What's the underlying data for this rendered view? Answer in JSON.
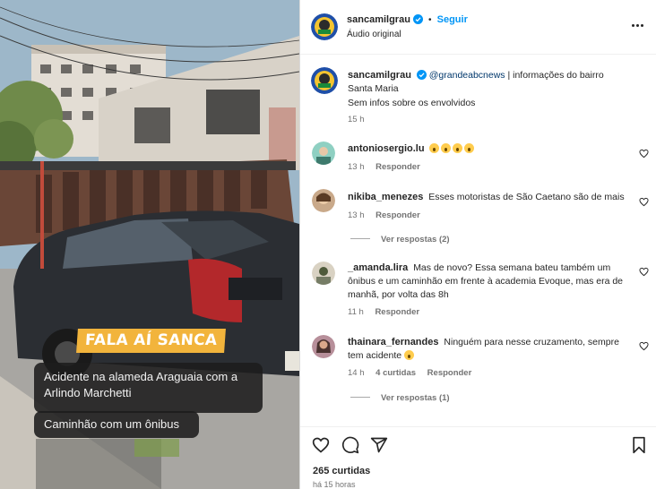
{
  "media": {
    "banner": "FALA AÍ SANCA",
    "caption_1": "Acidente na alameda Araguaia com a Arlindo Marchetti",
    "caption_2": "Caminhão com um ônibus"
  },
  "header": {
    "username": "sancamilgrau",
    "follow_label": "Seguir",
    "separator": "•",
    "audio_label": "Áudio original"
  },
  "caption_post": {
    "username": "sancamilgrau",
    "mention": "@grandeabcnews",
    "text": " | informações do bairro Santa Maria",
    "line2": "Sem infos sobre os envolvidos",
    "time": "15 h"
  },
  "comments": [
    {
      "username": "antoniosergio.lu",
      "text": "",
      "emoji_count": 4,
      "time": "13 h",
      "likes": "",
      "reply": "Responder",
      "view_replies": ""
    },
    {
      "username": "nikiba_menezes",
      "text": "Esses motoristas de São Caetano são de mais",
      "time": "13 h",
      "likes": "",
      "reply": "Responder",
      "view_replies": "Ver respostas (2)"
    },
    {
      "username": "_amanda.lira",
      "text": "Mas de novo? Essa semana bateu também um ônibus e um caminhão em frente à academia Evoque, mas era de manhã, por volta das 8h",
      "time": "11 h",
      "likes": "",
      "reply": "Responder",
      "view_replies": ""
    },
    {
      "username": "thainara_fernandes",
      "text": "Ninguém para nesse cruzamento, sempre tem acidente",
      "time": "14 h",
      "likes": "4 curtidas",
      "reply": "Responder",
      "view_replies": "Ver respostas (1)"
    }
  ],
  "footer": {
    "likes": "265 curtidas",
    "ago": "há 15 horas"
  },
  "colors": {
    "accent": "#0095f6",
    "mention": "#00376b",
    "muted": "#737373",
    "banner": "#f2b43c"
  },
  "icons": [
    "verified-badge-icon",
    "more-options-icon",
    "heart-icon",
    "comment-icon",
    "share-icon",
    "bookmark-icon"
  ]
}
